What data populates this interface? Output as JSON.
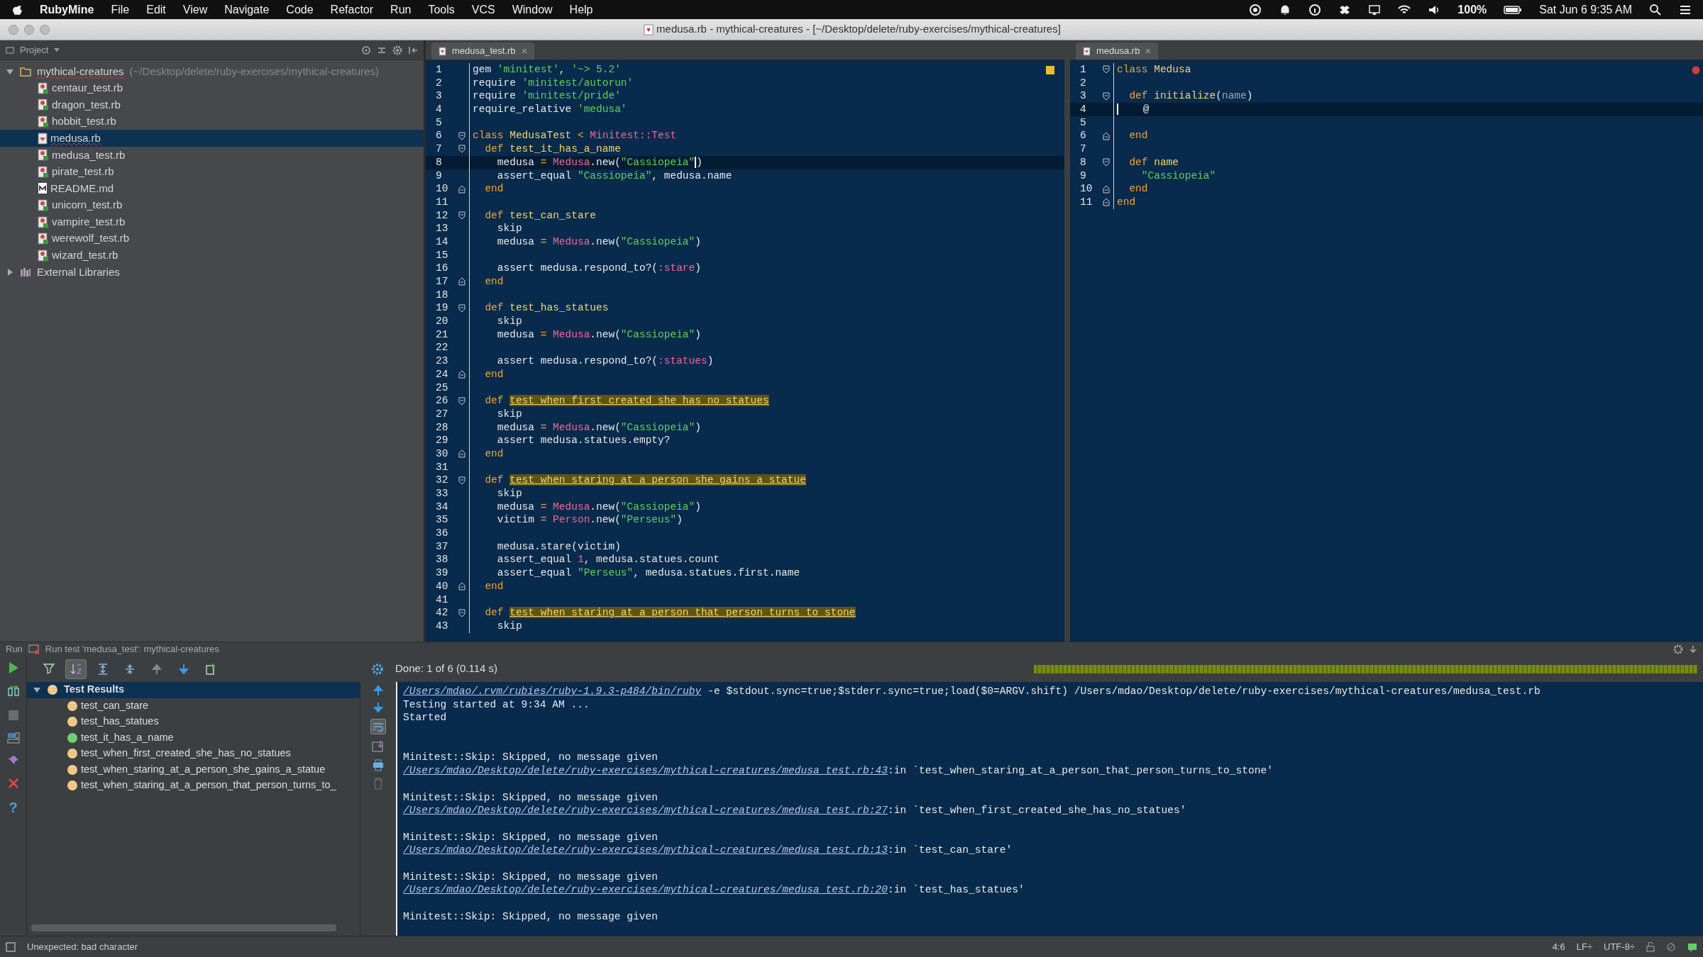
{
  "menu_bar": {
    "app": "RubyMine",
    "items": [
      "File",
      "Edit",
      "View",
      "Navigate",
      "Code",
      "Refactor",
      "Run",
      "Tools",
      "VCS",
      "Window",
      "Help"
    ],
    "battery": "100%",
    "clock": "Sat Jun 6 9:35 AM"
  },
  "window": {
    "title": "medusa.rb - mythical-creatures - [~/Desktop/delete/ruby-exercises/mythical-creatures]"
  },
  "project": {
    "header": "Project",
    "root": {
      "label": "mythical-creatures",
      "path": "(~/Desktop/delete/ruby-exercises/mythical-creatures)",
      "expanded": true,
      "error": true,
      "children": [
        {
          "label": "centaur_test.rb",
          "kind": "ruby-test",
          "selected": false,
          "error": false
        },
        {
          "label": "dragon_test.rb",
          "kind": "ruby-test",
          "selected": false,
          "error": false
        },
        {
          "label": "hobbit_test.rb",
          "kind": "ruby-test",
          "selected": false,
          "error": false
        },
        {
          "label": "medusa.rb",
          "kind": "ruby",
          "selected": true,
          "error": true
        },
        {
          "label": "medusa_test.rb",
          "kind": "ruby-test",
          "selected": false,
          "error": false
        },
        {
          "label": "pirate_test.rb",
          "kind": "ruby-test",
          "selected": false,
          "error": false
        },
        {
          "label": "README.md",
          "kind": "markdown",
          "selected": false,
          "error": false
        },
        {
          "label": "unicorn_test.rb",
          "kind": "ruby-test",
          "selected": false,
          "error": false
        },
        {
          "label": "vampire_test.rb",
          "kind": "ruby-test",
          "selected": false,
          "error": false
        },
        {
          "label": "werewolf_test.rb",
          "kind": "ruby-test",
          "selected": false,
          "error": false
        },
        {
          "label": "wizard_test.rb",
          "kind": "ruby-test",
          "selected": false,
          "error": false
        }
      ]
    },
    "libraries": {
      "label": "External Libraries",
      "expanded": false
    }
  },
  "editors": [
    {
      "tab": "medusa_test.rb",
      "lines": [
        {
          "number": "1",
          "kind": "code",
          "current": false,
          "tokens": [
            {
              "kind": "plain",
              "text": "gem "
            },
            {
              "kind": "string",
              "text": "'minitest'"
            },
            {
              "kind": "plain",
              "text": ", "
            },
            {
              "kind": "string",
              "text": "'~> 5.2'"
            }
          ]
        },
        {
          "number": "2",
          "kind": "code",
          "current": false,
          "tokens": [
            {
              "kind": "plain",
              "text": "require "
            },
            {
              "kind": "string",
              "text": "'minitest/autorun'"
            }
          ]
        },
        {
          "number": "3",
          "kind": "code",
          "current": false,
          "tokens": [
            {
              "kind": "plain",
              "text": "require "
            },
            {
              "kind": "string",
              "text": "'minitest/pride'"
            }
          ]
        },
        {
          "number": "4",
          "kind": "code",
          "current": false,
          "tokens": [
            {
              "kind": "plain",
              "text": "require_relative "
            },
            {
              "kind": "string",
              "text": "'medusa'"
            }
          ]
        },
        {
          "number": "5",
          "kind": "code",
          "current": false
        },
        {
          "number": "6",
          "kind": "fold-start",
          "current": false,
          "tokens": [
            {
              "kind": "keyword",
              "text": "class "
            },
            {
              "kind": "name",
              "text": "MedusaTest"
            },
            {
              "kind": "keyword",
              "text": " < "
            },
            {
              "kind": "constant",
              "text": "Minitest::Test"
            }
          ]
        },
        {
          "number": "7",
          "kind": "fold-start",
          "current": false,
          "tokens": [
            {
              "kind": "keyword",
              "text": "  def "
            },
            {
              "kind": "name",
              "text": "test_it_has_a_name"
            }
          ]
        },
        {
          "number": "8",
          "kind": "code",
          "current": true,
          "tokens": [
            {
              "kind": "plain",
              "text": "    medusa "
            },
            {
              "kind": "keyword",
              "text": "="
            },
            {
              "kind": "constant",
              "text": " Medusa"
            },
            {
              "kind": "plain",
              "text": ".new("
            },
            {
              "kind": "string",
              "text": "\"Cassiopeia\""
            },
            {
              "kind": "plain",
              "text": ")"
            }
          ]
        },
        {
          "number": "9",
          "kind": "code",
          "current": false,
          "tokens": [
            {
              "kind": "plain",
              "text": "    assert_equal "
            },
            {
              "kind": "string",
              "text": "\"Cassiopeia\""
            },
            {
              "kind": "plain",
              "text": ", medusa.name"
            }
          ]
        },
        {
          "number": "10",
          "kind": "fold-end",
          "current": false,
          "tokens": [
            {
              "kind": "keyword",
              "text": "  end"
            }
          ]
        },
        {
          "number": "11",
          "kind": "code",
          "current": false
        },
        {
          "number": "12",
          "kind": "fold-start",
          "current": false,
          "tokens": [
            {
              "kind": "keyword",
              "text": "  def "
            },
            {
              "kind": "name",
              "text": "test_can_stare"
            }
          ]
        },
        {
          "number": "13",
          "kind": "code",
          "current": false,
          "tokens": [
            {
              "kind": "plain",
              "text": "    skip"
            }
          ]
        },
        {
          "number": "14",
          "kind": "code",
          "current": false,
          "tokens": [
            {
              "kind": "plain",
              "text": "    medusa "
            },
            {
              "kind": "keyword",
              "text": "="
            },
            {
              "kind": "constant",
              "text": " Medusa"
            },
            {
              "kind": "plain",
              "text": ".new("
            },
            {
              "kind": "string",
              "text": "\"Cassiopeia\""
            },
            {
              "kind": "plain",
              "text": ")"
            }
          ]
        },
        {
          "number": "15",
          "kind": "code",
          "current": false
        },
        {
          "number": "16",
          "kind": "code",
          "current": false,
          "tokens": [
            {
              "kind": "plain",
              "text": "    assert medusa.respond_to?("
            },
            {
              "kind": "constant",
              "text": ":stare"
            },
            {
              "kind": "plain",
              "text": ")"
            }
          ]
        },
        {
          "number": "17",
          "kind": "fold-end",
          "current": false,
          "tokens": [
            {
              "kind": "keyword",
              "text": "  end"
            }
          ]
        },
        {
          "number": "18",
          "kind": "code",
          "current": false
        },
        {
          "number": "19",
          "kind": "fold-start",
          "current": false,
          "tokens": [
            {
              "kind": "keyword",
              "text": "  def "
            },
            {
              "kind": "name",
              "text": "test_has_statues"
            }
          ]
        },
        {
          "number": "20",
          "kind": "code",
          "current": false,
          "tokens": [
            {
              "kind": "plain",
              "text": "    skip"
            }
          ]
        },
        {
          "number": "21",
          "kind": "code",
          "current": false,
          "tokens": [
            {
              "kind": "plain",
              "text": "    medusa "
            },
            {
              "kind": "keyword",
              "text": "="
            },
            {
              "kind": "constant",
              "text": " Medusa"
            },
            {
              "kind": "plain",
              "text": ".new("
            },
            {
              "kind": "string",
              "text": "\"Cassiopeia\""
            },
            {
              "kind": "plain",
              "text": ")"
            }
          ]
        },
        {
          "number": "22",
          "kind": "code",
          "current": false
        },
        {
          "number": "23",
          "kind": "code",
          "current": false,
          "tokens": [
            {
              "kind": "plain",
              "text": "    assert medusa.respond_to?("
            },
            {
              "kind": "constant",
              "text": ":statues"
            },
            {
              "kind": "plain",
              "text": ")"
            }
          ]
        },
        {
          "number": "24",
          "kind": "fold-end",
          "current": false,
          "tokens": [
            {
              "kind": "keyword",
              "text": "  end"
            }
          ]
        },
        {
          "number": "25",
          "kind": "code",
          "current": false
        },
        {
          "number": "26",
          "kind": "fold-start",
          "current": false,
          "tokens": [
            {
              "kind": "keyword",
              "text": "  def "
            },
            {
              "kind": "highlight",
              "text": "test_when_first_created_she_has_no_statues"
            }
          ]
        },
        {
          "number": "27",
          "kind": "code",
          "current": false,
          "tokens": [
            {
              "kind": "plain",
              "text": "    skip"
            }
          ]
        },
        {
          "number": "28",
          "kind": "code",
          "current": false,
          "tokens": [
            {
              "kind": "plain",
              "text": "    medusa "
            },
            {
              "kind": "keyword",
              "text": "="
            },
            {
              "kind": "constant",
              "text": " Medusa"
            },
            {
              "kind": "plain",
              "text": ".new("
            },
            {
              "kind": "string",
              "text": "\"Cassiopeia\""
            },
            {
              "kind": "plain",
              "text": ")"
            }
          ]
        },
        {
          "number": "29",
          "kind": "code",
          "current": false,
          "tokens": [
            {
              "kind": "plain",
              "text": "    assert medusa.statues.empty?"
            }
          ]
        },
        {
          "number": "30",
          "kind": "fold-end",
          "current": false,
          "tokens": [
            {
              "kind": "keyword",
              "text": "  end"
            }
          ]
        },
        {
          "number": "31",
          "kind": "code",
          "current": false
        },
        {
          "number": "32",
          "kind": "fold-start",
          "current": false,
          "tokens": [
            {
              "kind": "keyword",
              "text": "  def "
            },
            {
              "kind": "highlight",
              "text": "test_when_staring_at_a_person_she_gains_a_statue"
            }
          ]
        },
        {
          "number": "33",
          "kind": "code",
          "current": false,
          "tokens": [
            {
              "kind": "plain",
              "text": "    skip"
            }
          ]
        },
        {
          "number": "34",
          "kind": "code",
          "current": false,
          "tokens": [
            {
              "kind": "plain",
              "text": "    medusa "
            },
            {
              "kind": "keyword",
              "text": "="
            },
            {
              "kind": "constant",
              "text": " Medusa"
            },
            {
              "kind": "plain",
              "text": ".new("
            },
            {
              "kind": "string",
              "text": "\"Cassiopeia\""
            },
            {
              "kind": "plain",
              "text": ")"
            }
          ]
        },
        {
          "number": "35",
          "kind": "code",
          "current": false,
          "tokens": [
            {
              "kind": "plain",
              "text": "    victim "
            },
            {
              "kind": "keyword",
              "text": "="
            },
            {
              "kind": "constant",
              "text": " Person"
            },
            {
              "kind": "plain",
              "text": ".new("
            },
            {
              "kind": "string",
              "text": "\"Perseus\""
            },
            {
              "kind": "plain",
              "text": ")"
            }
          ]
        },
        {
          "number": "36",
          "kind": "code",
          "current": false
        },
        {
          "number": "37",
          "kind": "code",
          "current": false,
          "tokens": [
            {
              "kind": "plain",
              "text": "    medusa.stare(victim)"
            }
          ]
        },
        {
          "number": "38",
          "kind": "code",
          "current": false,
          "tokens": [
            {
              "kind": "plain",
              "text": "    assert_equal "
            },
            {
              "kind": "constant",
              "text": "1"
            },
            {
              "kind": "plain",
              "text": ", medusa.statues.count"
            }
          ]
        },
        {
          "number": "39",
          "kind": "code",
          "current": false,
          "tokens": [
            {
              "kind": "plain",
              "text": "    assert_equal "
            },
            {
              "kind": "string",
              "text": "\"Perseus\""
            },
            {
              "kind": "plain",
              "text": ", medusa.statues.first.name"
            }
          ]
        },
        {
          "number": "40",
          "kind": "fold-end",
          "current": false,
          "tokens": [
            {
              "kind": "keyword",
              "text": "  end"
            }
          ]
        },
        {
          "number": "41",
          "kind": "code",
          "current": false
        },
        {
          "number": "42",
          "kind": "fold-start",
          "current": false,
          "tokens": [
            {
              "kind": "keyword",
              "text": "  def "
            },
            {
              "kind": "highlight",
              "text": "test_when_staring_at_a_person_that_person_turns_to_stone"
            }
          ]
        },
        {
          "number": "43",
          "kind": "code",
          "current": false,
          "tokens": [
            {
              "kind": "plain",
              "text": "    skip"
            }
          ]
        }
      ]
    },
    {
      "tab": "medusa.rb",
      "lines": [
        {
          "number": "1",
          "kind": "fold-start",
          "current": false,
          "tokens": [
            {
              "kind": "keyword",
              "text": "class "
            },
            {
              "kind": "name",
              "text": "Medusa"
            }
          ]
        },
        {
          "number": "2",
          "kind": "code",
          "current": false
        },
        {
          "number": "3",
          "kind": "fold-start",
          "current": false,
          "tokens": [
            {
              "kind": "keyword",
              "text": "  def "
            },
            {
              "kind": "name",
              "text": "initialize"
            },
            {
              "kind": "plain",
              "text": "("
            },
            {
              "kind": "param",
              "text": "name"
            },
            {
              "kind": "plain",
              "text": ")"
            }
          ]
        },
        {
          "number": "4",
          "kind": "code",
          "current": true,
          "tokens": [
            {
              "kind": "plain",
              "text": "    @"
            }
          ]
        },
        {
          "number": "5",
          "kind": "code",
          "current": false
        },
        {
          "number": "6",
          "kind": "fold-end",
          "current": false,
          "tokens": [
            {
              "kind": "keyword",
              "text": "  end"
            }
          ]
        },
        {
          "number": "7",
          "kind": "code",
          "current": false
        },
        {
          "number": "8",
          "kind": "fold-start",
          "current": false,
          "tokens": [
            {
              "kind": "keyword",
              "text": "  def "
            },
            {
              "kind": "name",
              "text": "name"
            }
          ]
        },
        {
          "number": "9",
          "kind": "code",
          "current": false,
          "tokens": [
            {
              "kind": "string",
              "text": "    \"Cassiopeia\""
            }
          ]
        },
        {
          "number": "10",
          "kind": "fold-end",
          "current": false,
          "tokens": [
            {
              "kind": "keyword",
              "text": "  end"
            }
          ]
        },
        {
          "number": "11",
          "kind": "fold-end",
          "current": false,
          "tokens": [
            {
              "kind": "keyword",
              "text": "end"
            }
          ]
        }
      ]
    }
  ],
  "run": {
    "label": "Run",
    "config": "Run test 'medusa_test': mythical-creatures",
    "toolbar": [
      {
        "kind": "filter",
        "pressed": false
      },
      {
        "kind": "sort",
        "pressed": true
      },
      {
        "kind": "expand",
        "pressed": false
      },
      {
        "kind": "collapse",
        "pressed": false
      },
      {
        "kind": "up",
        "pressed": false
      },
      {
        "kind": "down",
        "pressed": false
      },
      {
        "kind": "export",
        "pressed": false
      }
    ],
    "help": "?",
    "done": "Done: 1 of 6  (0.114 s)",
    "progress": {
      "level": 1
    },
    "results": {
      "label": "Test Results",
      "kind": "skipped",
      "expanded": true,
      "selected": true,
      "children": [
        {
          "label": "test_can_stare",
          "kind": "skipped",
          "selected": false
        },
        {
          "label": "test_has_statues",
          "kind": "skipped",
          "selected": false
        },
        {
          "label": "test_it_has_a_name",
          "kind": "passed",
          "selected": false
        },
        {
          "label": "test_when_first_created_she_has_no_statues",
          "kind": "skipped",
          "selected": false
        },
        {
          "label": "test_when_staring_at_a_person_she_gains_a_statue",
          "kind": "skipped",
          "selected": false
        },
        {
          "label": "test_when_staring_at_a_person_that_person_turns_to_",
          "kind": "skipped",
          "selected": false
        }
      ]
    },
    "console": [
      {
        "kind": "text",
        "tokens": [
          {
            "kind": "link",
            "text": "/Users/mdao/.rvm/rubies/ruby-1.9.3-p484/bin/ruby"
          },
          {
            "kind": "plain",
            "text": " -e $stdout.sync=true;$stderr.sync=true;load($0=ARGV.shift) /Users/mdao/Desktop/delete/ruby-exercises/mythical-creatures/medusa_test.rb"
          }
        ]
      },
      {
        "kind": "text",
        "tokens": [
          {
            "kind": "plain",
            "text": "Testing started at 9:34 AM ..."
          }
        ]
      },
      {
        "kind": "text",
        "tokens": [
          {
            "kind": "plain",
            "text": "Started"
          }
        ]
      },
      {
        "kind": "blank"
      },
      {
        "kind": "blank"
      },
      {
        "kind": "text",
        "tokens": [
          {
            "kind": "plain",
            "text": "Minitest::Skip: Skipped, no message given"
          }
        ]
      },
      {
        "kind": "text",
        "tokens": [
          {
            "kind": "link",
            "text": "/Users/mdao/Desktop/delete/ruby-exercises/mythical-creatures/medusa_test.rb:43"
          },
          {
            "kind": "plain",
            "text": ":in `test_when_staring_at_a_person_that_person_turns_to_stone'"
          }
        ]
      },
      {
        "kind": "blank"
      },
      {
        "kind": "text",
        "tokens": [
          {
            "kind": "plain",
            "text": "Minitest::Skip: Skipped, no message given"
          }
        ]
      },
      {
        "kind": "text",
        "tokens": [
          {
            "kind": "link",
            "text": "/Users/mdao/Desktop/delete/ruby-exercises/mythical-creatures/medusa_test.rb:27"
          },
          {
            "kind": "plain",
            "text": ":in `test_when_first_created_she_has_no_statues'"
          }
        ]
      },
      {
        "kind": "blank"
      },
      {
        "kind": "text",
        "tokens": [
          {
            "kind": "plain",
            "text": "Minitest::Skip: Skipped, no message given"
          }
        ]
      },
      {
        "kind": "text",
        "tokens": [
          {
            "kind": "link",
            "text": "/Users/mdao/Desktop/delete/ruby-exercises/mythical-creatures/medusa_test.rb:13"
          },
          {
            "kind": "plain",
            "text": ":in `test_can_stare'"
          }
        ]
      },
      {
        "kind": "blank"
      },
      {
        "kind": "text",
        "tokens": [
          {
            "kind": "plain",
            "text": "Minitest::Skip: Skipped, no message given"
          }
        ]
      },
      {
        "kind": "text",
        "tokens": [
          {
            "kind": "link",
            "text": "/Users/mdao/Desktop/delete/ruby-exercises/mythical-creatures/medusa_test.rb:20"
          },
          {
            "kind": "plain",
            "text": ":in `test_has_statues'"
          }
        ]
      },
      {
        "kind": "blank"
      },
      {
        "kind": "text",
        "tokens": [
          {
            "kind": "plain",
            "text": "Minitest::Skip: Skipped, no message given"
          }
        ]
      }
    ]
  },
  "status_bar": {
    "message": "Unexpected: bad character",
    "position": "4:6",
    "line_separator": "LF÷",
    "encoding": "UTF-8÷"
  }
}
